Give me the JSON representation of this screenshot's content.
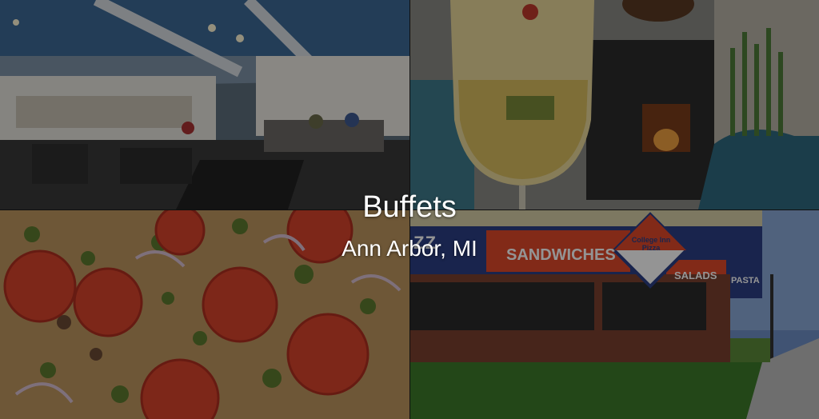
{
  "overlay": {
    "title": "Buffets",
    "subtitle": "Ann Arbor, MI"
  },
  "storefront": {
    "awning_left": "ZZ",
    "sandwiches": "SANDWICHES",
    "salads": "SALADS",
    "pasta": "PASTA",
    "logo_line1": "College Inn",
    "logo_line2": "Pizza"
  },
  "colors": {
    "awning_red": "#e0492a",
    "awning_blue": "#2b3f86",
    "overlay_text": "#ffffff"
  }
}
